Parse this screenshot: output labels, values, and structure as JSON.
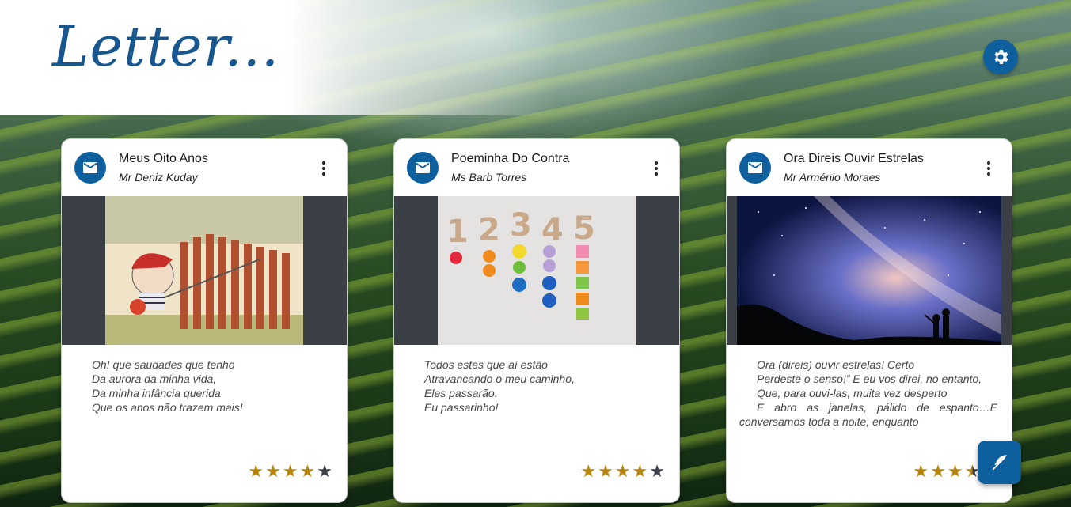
{
  "app": {
    "logo": "Letter..."
  },
  "colors": {
    "brand": "#0d5f9e",
    "star_on": "#b8860b",
    "star_off": "#3d424a"
  },
  "header": {
    "settings_icon": "gear-icon"
  },
  "cards": [
    {
      "title": "Meus Oito Anos",
      "author": "Mr Deniz Kuday",
      "avatar_icon": "mail-icon",
      "menu_icon": "more-vert-icon",
      "poem": [
        "Oh! que saudades que tenho",
        "Da aurora da minha vida,",
        "Da minha infância querida",
        "Que os anos não trazem mais!"
      ],
      "rating": 4,
      "rating_max": 5
    },
    {
      "title": "Poeminha Do Contra",
      "author": "Ms Barb Torres",
      "avatar_icon": "mail-icon",
      "menu_icon": "more-vert-icon",
      "poem": [
        "Todos estes que aí estão",
        "Atravancando o meu caminho,",
        "Eles passarão.",
        "Eu passarinho!"
      ],
      "rating": 4,
      "rating_max": 5
    },
    {
      "title": "Ora Direis Ouvir Estrelas",
      "author": "Mr Arménio Moraes",
      "avatar_icon": "mail-icon",
      "menu_icon": "more-vert-icon",
      "poem": [
        "Ora (direis) ouvir estrelas! Certo",
        "Perdeste o senso!” E eu vos direi, no entanto,",
        "Que, para ouvi-las, muita vez desperto",
        "E abro as janelas, pálido de espanto…E",
        "conversamos toda a noite, enquanto"
      ],
      "rating": 3.5,
      "rating_max": 5
    }
  ],
  "fab": {
    "icon": "feather-icon"
  }
}
